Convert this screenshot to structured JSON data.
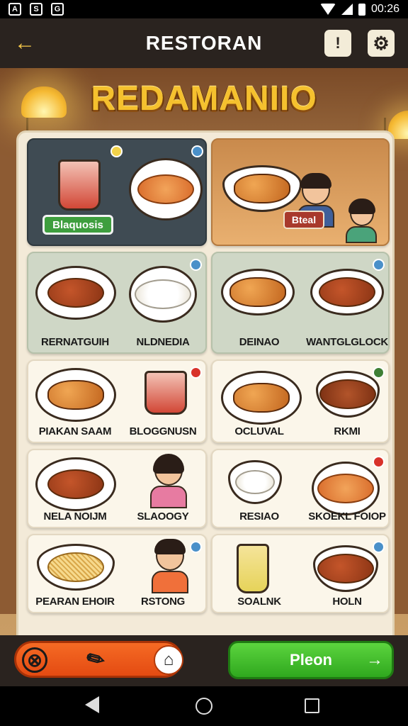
{
  "status_bar": {
    "time": "00:26",
    "left_icons": [
      "app-icon-1",
      "app-icon-2",
      "app-icon-3"
    ]
  },
  "header": {
    "title": "RESTORAN",
    "back_icon": "←",
    "alert_icon": "!",
    "settings_icon": "⚙"
  },
  "restaurant": {
    "name": "REDAMANIIO"
  },
  "featured": {
    "left_tag": "Blaquosis",
    "right_tag": "Bteal"
  },
  "menu_cards": [
    {
      "left": "RERNATGUIH",
      "right": "NLDNEDIA"
    },
    {
      "left": "DEINAO",
      "right": "WANTGLGLOCK"
    },
    {
      "left": "PIAKAN SAAM",
      "right": "BLOGGNUSN"
    },
    {
      "left": "OCLUVAL",
      "right": "RKMI"
    },
    {
      "left": "NELA NOIJM",
      "right": "SLAOOGY"
    },
    {
      "left": "RESIAO",
      "right": "SKOEKL FOIOP"
    },
    {
      "left": "PEARAN EHOIR",
      "right": "RSTONG"
    },
    {
      "left": "SOALNK",
      "right": "HOLN"
    }
  ],
  "bottom_bar": {
    "proceed_label": "Pleon",
    "proceed_arrow": "→",
    "home_icon": "⌂",
    "cancel_icon": "⊗",
    "tool_icon": "✎"
  },
  "colors": {
    "accent": "#f5c12e",
    "header": "#2a231f",
    "proceed": "#3fba2a",
    "tool_pill": "#f05a1a"
  }
}
